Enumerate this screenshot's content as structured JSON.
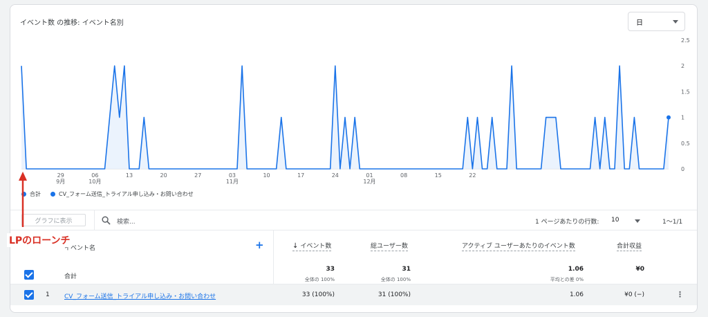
{
  "card": {
    "title": "イベント数 の推移: イベント名別",
    "granularity": "日"
  },
  "chart_data": {
    "type": "line",
    "y_ticks": [
      "2.5",
      "2",
      "1.5",
      "1",
      "0.5",
      "0"
    ],
    "ylim": [
      0,
      2.5
    ],
    "x_tick_labels": [
      {
        "day": "29",
        "month": "9月",
        "index": 8
      },
      {
        "day": "06",
        "month": "10月",
        "index": 15
      },
      {
        "day": "13",
        "month": "",
        "index": 22
      },
      {
        "day": "20",
        "month": "",
        "index": 29
      },
      {
        "day": "27",
        "month": "",
        "index": 36
      },
      {
        "day": "03",
        "month": "11月",
        "index": 43
      },
      {
        "day": "10",
        "month": "",
        "index": 50
      },
      {
        "day": "17",
        "month": "",
        "index": 57
      },
      {
        "day": "24",
        "month": "",
        "index": 64
      },
      {
        "day": "01",
        "month": "12月",
        "index": 71
      },
      {
        "day": "08",
        "month": "",
        "index": 78
      },
      {
        "day": "15",
        "month": "",
        "index": 85
      },
      {
        "day": "22",
        "month": "",
        "index": 92
      }
    ],
    "series": [
      {
        "name": "CV_フォーム送信_トライアル申し込み・お問い合わせ",
        "color": "#1a73e8",
        "values": [
          2,
          0,
          0,
          0,
          0,
          0,
          0,
          0,
          0,
          0,
          0,
          0,
          0,
          0,
          0,
          0,
          0,
          0,
          1,
          2,
          1,
          2,
          0,
          0,
          0,
          1,
          0,
          0,
          0,
          0,
          0,
          0,
          0,
          0,
          0,
          0,
          0,
          0,
          0,
          0,
          0,
          0,
          0,
          0,
          0,
          2,
          0,
          0,
          0,
          0,
          0,
          0,
          0,
          1,
          0,
          0,
          0,
          0,
          0,
          0,
          0,
          0,
          0,
          0,
          2,
          0,
          1,
          0,
          1,
          0,
          0,
          0,
          0,
          0,
          0,
          0,
          0,
          0,
          0,
          0,
          0,
          0,
          0,
          0,
          0,
          0,
          0,
          0,
          0,
          0,
          0,
          1,
          0,
          1,
          0,
          0,
          1,
          0,
          0,
          0,
          2,
          0,
          0,
          0,
          0,
          0,
          0,
          1,
          1,
          1,
          0,
          0,
          0,
          0,
          0,
          0,
          0,
          1,
          0,
          1,
          0,
          0,
          2,
          0,
          0,
          1,
          0,
          0,
          0,
          0,
          0,
          0,
          1
        ]
      }
    ]
  },
  "legend": {
    "total_label": "合計",
    "series_label": "CV_フォーム送信_トライアル申し込み・お問い合わせ"
  },
  "toolbar": {
    "graph_button": "グラフに表示",
    "search_placeholder": "検索...",
    "rows_label": "1 ページあたりの行数:",
    "rows_value": "10",
    "pager": "1〜1/1"
  },
  "table": {
    "dimension_header": "イベント名",
    "columns": [
      "イベント数",
      "総ユーザー数",
      "アクティブ ユーザーあたりのイベント数",
      "合計収益"
    ],
    "totals": {
      "label": "合計",
      "values": [
        "33",
        "31",
        "1.06",
        "¥0"
      ],
      "subs": [
        "全体の 100%",
        "全体の 100%",
        "平均との差 0%",
        ""
      ]
    },
    "rows": [
      {
        "index": "1",
        "name": "CV_フォーム送信_トライアル申し込み・お問い合わせ",
        "values": [
          "33 (100%)",
          "31 (100%)",
          "1.06",
          "¥0 (−)"
        ]
      }
    ]
  },
  "annotation": {
    "text": "LPのローンチ",
    "color": "#d93025"
  }
}
